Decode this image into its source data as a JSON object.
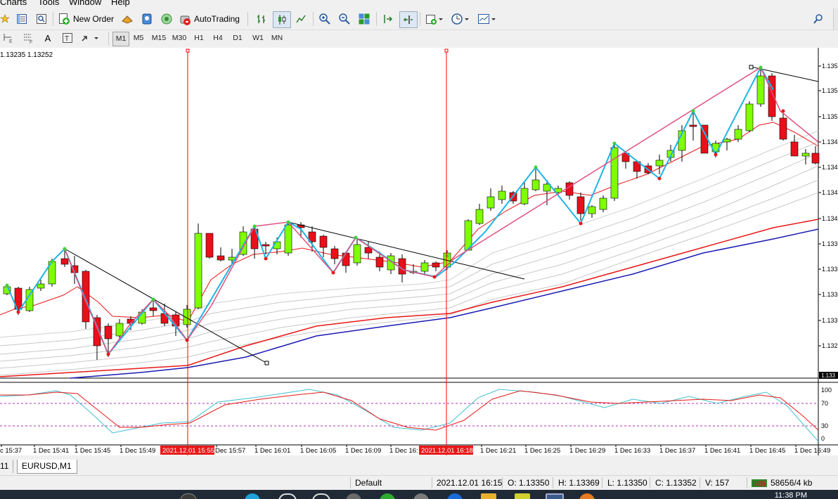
{
  "menu": [
    "Charts",
    "Tools",
    "Window",
    "Help"
  ],
  "toolbar": {
    "new_order_label": "New Order",
    "autotrading_label": "AutoTrading"
  },
  "timeframes": [
    "M1",
    "M5",
    "M15",
    "M30",
    "H1",
    "H4",
    "D1",
    "W1",
    "MN"
  ],
  "active_timeframe": "M1",
  "chart_info": "1.13235 1.13252",
  "price_axis_labels": [
    "1.135",
    "1.135",
    "1.135",
    "1.134",
    "1.134",
    "1.134",
    "1.134",
    "1.133",
    "1.133",
    "1.133",
    "1.133",
    "1.132"
  ],
  "current_price_tag": "1.133",
  "osc_axis_labels": [
    "100",
    "70",
    "30",
    "0"
  ],
  "time_labels": [
    "c 15:37",
    "1 Dec 15:41",
    "1 Dec 15:45",
    "1 Dec 15:49",
    "Dec 15:57",
    "1 Dec 16:01",
    "1 Dec 16:05",
    "1 Dec 16:09",
    "1 Dec 16:",
    "1 Dec 16:21",
    "1 Dec 16:25",
    "1 Dec 16:29",
    "1 Dec 16:33",
    "1 Dec 16:37",
    "1 Dec 16:41",
    "1 Dec 16:45",
    "1 Dec 16:49"
  ],
  "vline_labels": [
    "2021.12.01 15:55",
    "2021.12.01 16:18"
  ],
  "tabs": [
    "11",
    "EURUSD,M1"
  ],
  "status": {
    "profile": "Default",
    "datetime": "2021.12.01 16:15",
    "open": "O: 1.13350",
    "high": "H: 1.13369",
    "low": "L: 1.13350",
    "close": "C: 1.13352",
    "volume": "V: 157",
    "traffic": "58656/4 kb"
  },
  "clock": "11:38 PM",
  "colors": {
    "bull_candle": "#7fff00",
    "bear_candle": "#e8101a",
    "zigzag_blue": "#1eb4e6",
    "zigzag_pink": "#e0507e",
    "ma_red": "#e81818",
    "ma_blue": "#1a1ab4",
    "vline_red": "#ff0000"
  },
  "icons": [
    "star-icon",
    "market-watch-icon",
    "zoom-window-icon",
    "new-order-icon",
    "strategy-tester-icon",
    "signals-icon",
    "radio-icon",
    "autotrading-icon",
    "bar-chart-icon",
    "candle-chart-icon",
    "line-chart-icon",
    "zoom-in-icon",
    "zoom-out-icon",
    "tile-icon",
    "scroll-icon",
    "shift-icon",
    "indicators-icon",
    "periods-icon",
    "templates-icon",
    "search-icon",
    "cursor-icon",
    "fib-icon",
    "text-icon",
    "label-icon",
    "arrow-icon"
  ]
}
